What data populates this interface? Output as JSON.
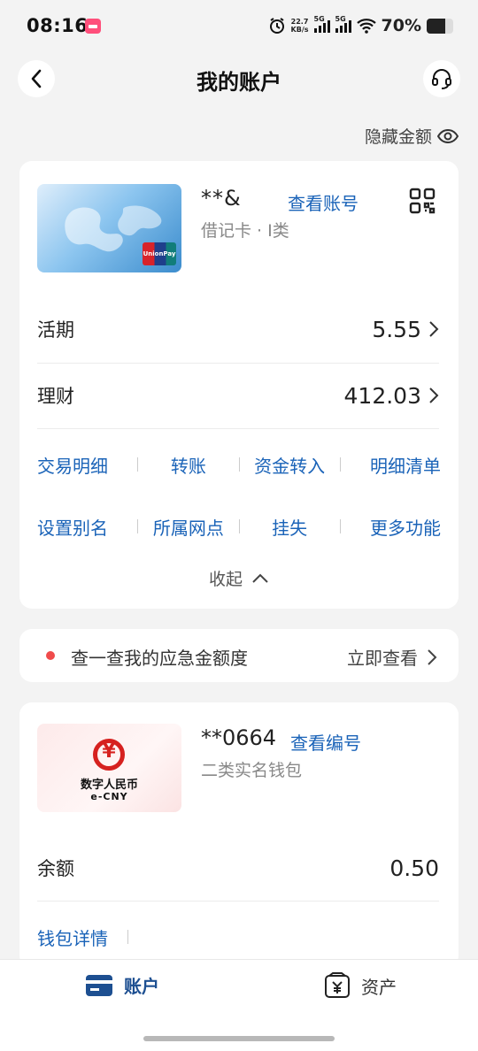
{
  "status_bar": {
    "time": "08:16",
    "net_speed_value": "22.7",
    "net_speed_unit": "KB/s",
    "sig1": "5G",
    "sig2": "5G",
    "battery": "70%"
  },
  "header": {
    "title": "我的账户"
  },
  "hide_amount_label": "隐藏金额",
  "bank_card": {
    "number_masked": "**&",
    "view_number_link": "查看账号",
    "type": "借记卡 · I类",
    "rows": [
      {
        "label": "活期",
        "value": "5.55"
      },
      {
        "label": "理财",
        "value": "412.03"
      }
    ],
    "functions_row1": [
      "交易明细",
      "转账",
      "资金转入",
      "明细清单"
    ],
    "functions_row2": [
      "设置别名",
      "所属网点",
      "挂失",
      "更多功能"
    ],
    "collapse_label": "收起"
  },
  "promo": {
    "text": "查一查我的应急金额度",
    "link": "立即查看"
  },
  "wallet": {
    "number_masked": "**0664",
    "view_number_link": "查看编号",
    "type": "二类实名钱包",
    "logo_text_cn": "数字人民币",
    "logo_text_en": "e-CNY",
    "balance_label": "余额",
    "balance_value": "0.50",
    "details_link": "钱包详情"
  },
  "tabs": [
    {
      "label": "账户",
      "active": true
    },
    {
      "label": "资产",
      "active": false
    }
  ],
  "colors": {
    "accent": "#1a63b8",
    "tab_active": "#1d4f91",
    "alert_dot": "#f04b4b"
  }
}
